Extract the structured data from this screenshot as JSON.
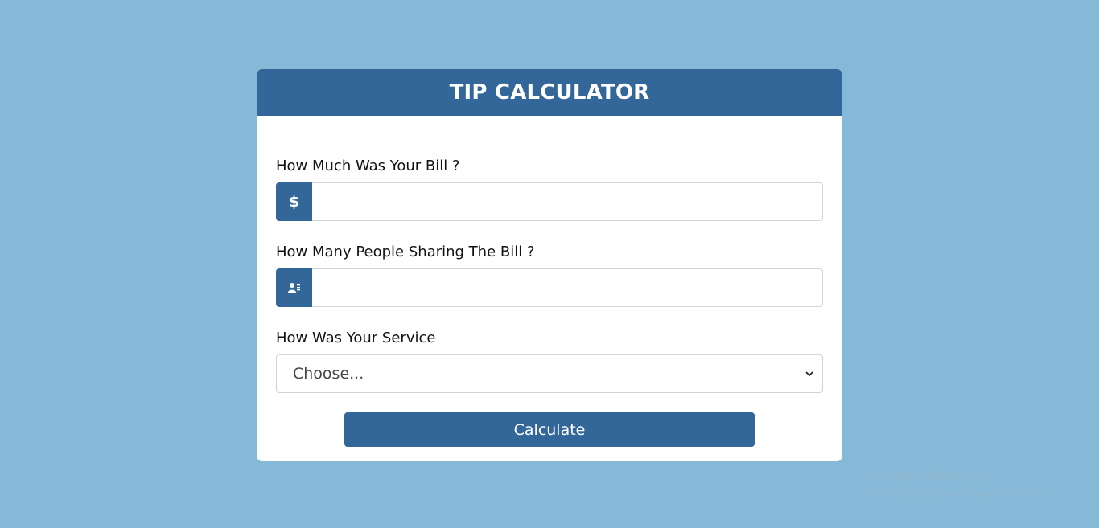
{
  "header": {
    "title": "TIP CALCULATOR"
  },
  "bill": {
    "label": "How Much Was Your Bill ?",
    "addon": "$",
    "value": "",
    "placeholder": ""
  },
  "people": {
    "label": "How Many People Sharing The Bill ?",
    "addon_icon": "person-list-icon",
    "value": "",
    "placeholder": ""
  },
  "service": {
    "label": "How Was Your Service",
    "selected": "Choose..."
  },
  "calculate_label": "Calculate",
  "watermark": {
    "title": "Activate Windows",
    "subtitle": "Go to Settings to activate Windows."
  },
  "colors": {
    "background": "#85b9d7",
    "accent": "#346799",
    "card": "#ffffff"
  }
}
